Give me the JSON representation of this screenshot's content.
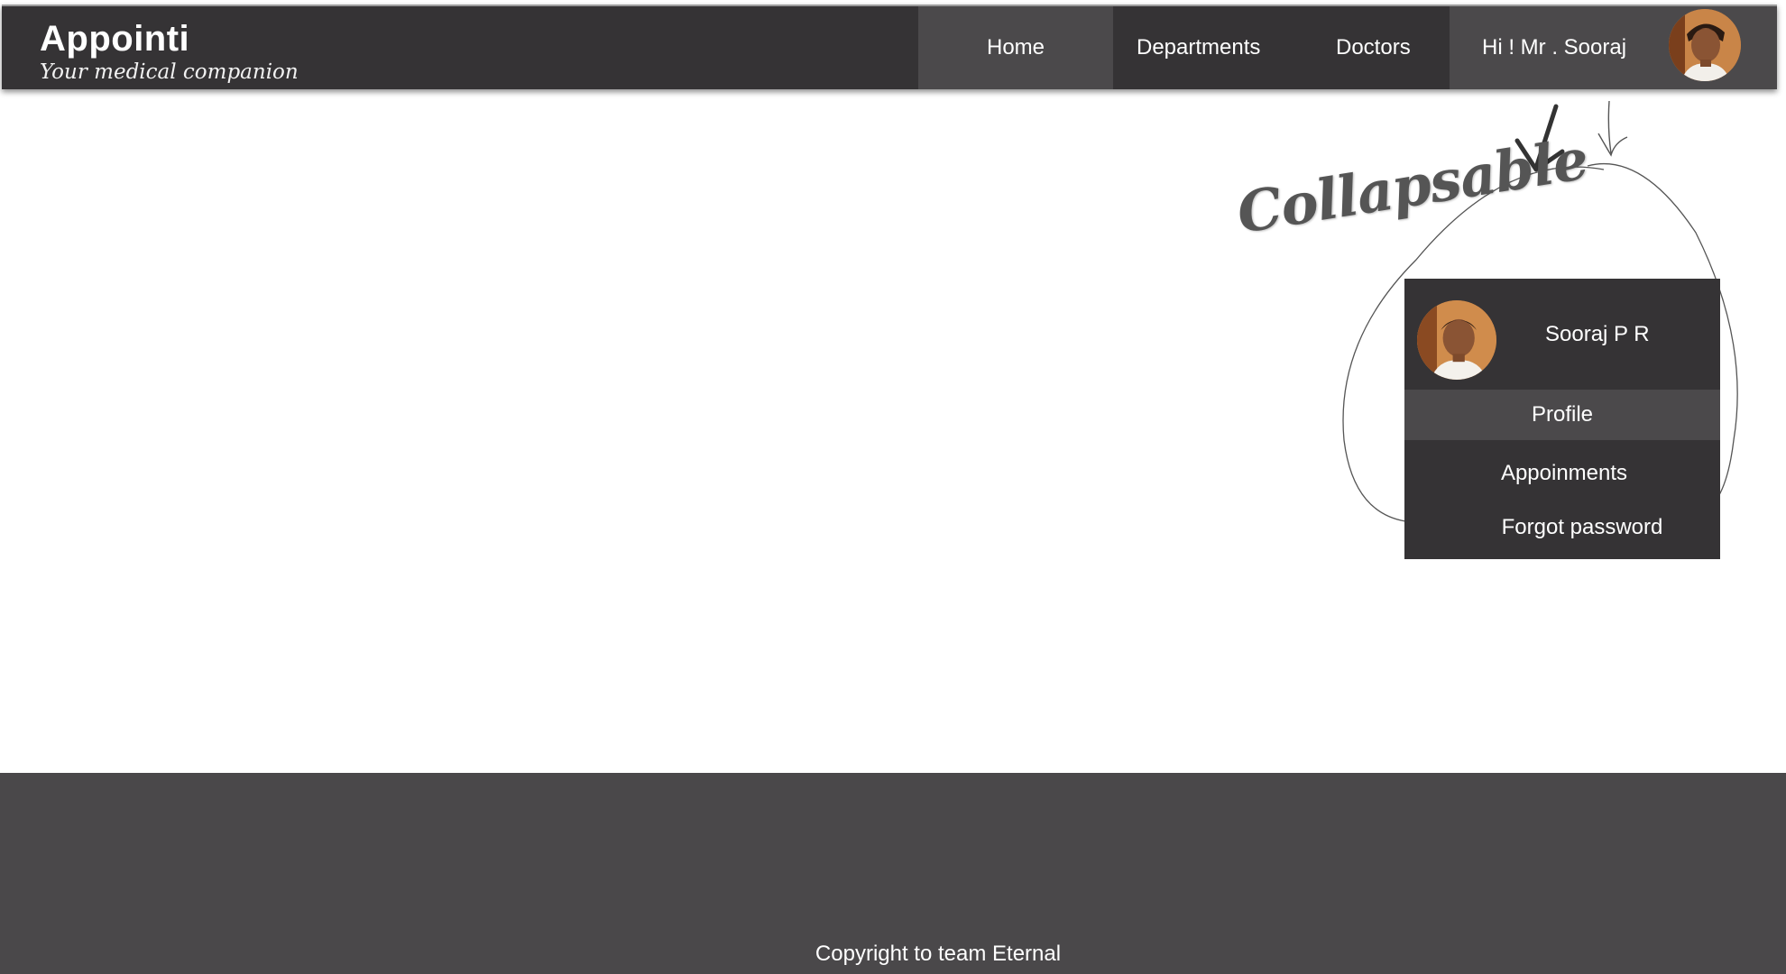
{
  "brand": {
    "title": "Appointi",
    "subtitle": "Your medical companion"
  },
  "nav": {
    "home": "Home",
    "departments": "Departments",
    "doctors": "Doctors",
    "greeting": "Hi ! Mr . Sooraj",
    "active": "Home"
  },
  "annotation": {
    "label": "Collapsable"
  },
  "dropdown": {
    "user_name": "Sooraj P R",
    "items": [
      {
        "label": "Profile",
        "highlighted": true
      },
      {
        "label": "Appoinments",
        "highlighted": false
      },
      {
        "label": "Forgot password",
        "highlighted": false
      }
    ]
  },
  "footer": {
    "copyright": "Copyright to team Eternal"
  },
  "colors": {
    "header_bg": "#353335",
    "nav_active_bg": "#4b494b",
    "dropdown_bg": "#353335",
    "footer_bg": "#4a484a",
    "text": "#ffffff"
  },
  "icons": {
    "avatar": "user-avatar-photo",
    "arrows": "hand-drawn-arrow"
  }
}
